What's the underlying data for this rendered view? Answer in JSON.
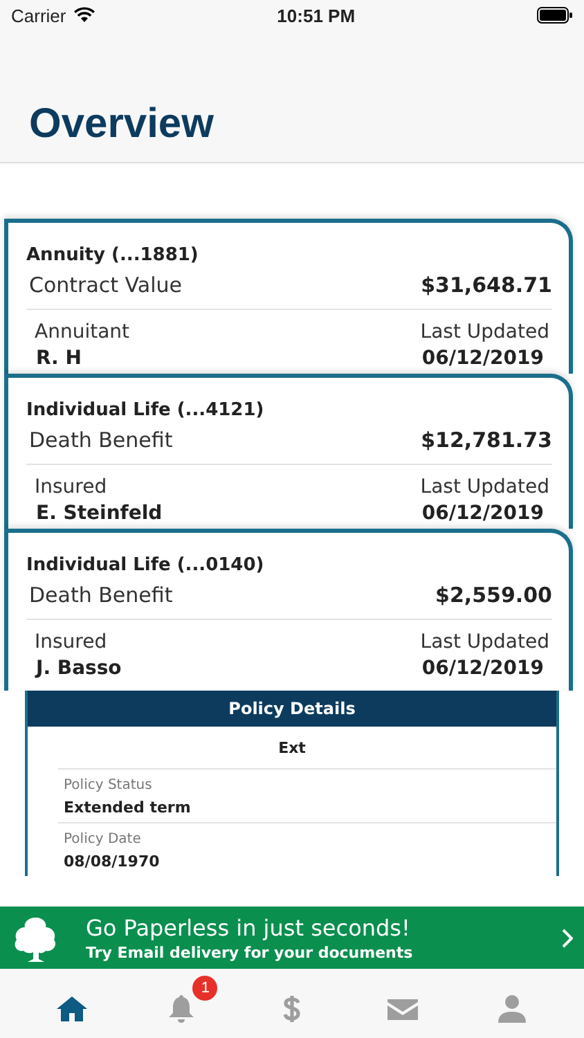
{
  "status_bar": {
    "carrier": "Carrier",
    "time": "10:51 PM"
  },
  "header": {
    "title": "Overview"
  },
  "policies": [
    {
      "title": "Annuity (...1881)",
      "value_label": "Contract Value",
      "value": "$31,648.71",
      "person_label": "Annuitant",
      "person": "R. H",
      "updated_label": "Last Updated",
      "updated": "06/12/2019"
    },
    {
      "title": "Individual Life (...4121)",
      "value_label": "Death Benefit",
      "value": "$12,781.73",
      "person_label": "Insured",
      "person": "E. Steinfeld",
      "updated_label": "Last Updated",
      "updated": "06/12/2019"
    },
    {
      "title": "Individual Life (...0140)",
      "value_label": "Death Benefit",
      "value": "$2,559.00",
      "person_label": "Insured",
      "person": "J. Basso",
      "updated_label": "Last Updated",
      "updated": "06/12/2019"
    }
  ],
  "policy_details": {
    "heading": "Policy Details",
    "code": "Ext",
    "fields": [
      {
        "label": "Policy Status",
        "value": "Extended term"
      },
      {
        "label": "Policy Date",
        "value": "08/08/1970"
      }
    ]
  },
  "banner": {
    "title": "Go Paperless in just seconds!",
    "subtitle": "Try Email delivery for your documents"
  },
  "tabs": [
    {
      "kind": "home",
      "selected": true
    },
    {
      "kind": "bell",
      "selected": false,
      "badge": "1"
    },
    {
      "kind": "dollar",
      "selected": false
    },
    {
      "kind": "mail",
      "selected": false
    },
    {
      "kind": "person",
      "selected": false
    }
  ]
}
